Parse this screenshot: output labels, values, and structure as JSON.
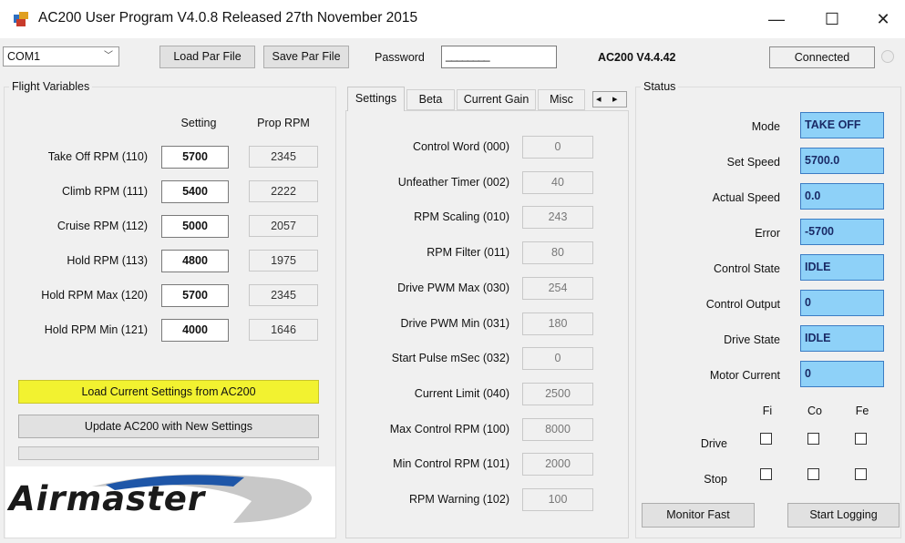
{
  "window": {
    "title": "AC200 User Program V4.0.8 Released 27th November 2015",
    "controls": {
      "minimize": "—",
      "maximize": "☐",
      "close": "✕"
    }
  },
  "toolbar": {
    "com_port": "COM1",
    "load_par_file": "Load Par File",
    "save_par_file": "Save Par File",
    "password_label": "Password",
    "password_value": "________",
    "version": "AC200 V4.4.42",
    "connection_status": "Connected"
  },
  "flight": {
    "title": "Flight Variables",
    "col_setting": "Setting",
    "col_prop_rpm": "Prop RPM",
    "rows": [
      {
        "label": "Take Off RPM (110)",
        "setting": "5700",
        "prop": "2345"
      },
      {
        "label": "Climb RPM (111)",
        "setting": "5400",
        "prop": "2222"
      },
      {
        "label": "Cruise RPM (112)",
        "setting": "5000",
        "prop": "2057"
      },
      {
        "label": "Hold RPM (113)",
        "setting": "4800",
        "prop": "1975"
      },
      {
        "label": "Hold RPM Max (120)",
        "setting": "5700",
        "prop": "2345"
      },
      {
        "label": "Hold RPM Min (121)",
        "setting": "4000",
        "prop": "1646"
      }
    ],
    "load_current": "Load Current Settings from AC200",
    "update": "Update AC200 with New Settings",
    "progress": 0
  },
  "logo": {
    "text": "Airmaster"
  },
  "tabs": {
    "labels": [
      "Settings",
      "Beta",
      "Current Gain",
      "Misc"
    ],
    "scroll_left": "◂",
    "scroll_right": "▸",
    "active": 0
  },
  "settings": [
    {
      "label": "Control Word (000)",
      "value": "0"
    },
    {
      "label": "Unfeather Timer (002)",
      "value": "40"
    },
    {
      "label": "RPM Scaling (010)",
      "value": "243"
    },
    {
      "label": "RPM Filter (011)",
      "value": "80"
    },
    {
      "label": "Drive PWM Max (030)",
      "value": "254"
    },
    {
      "label": "Drive PWM Min (031)",
      "value": "180"
    },
    {
      "label": "Start Pulse mSec (032)",
      "value": "0"
    },
    {
      "label": "Current Limit (040)",
      "value": "2500"
    },
    {
      "label": "Max Control RPM (100)",
      "value": "8000"
    },
    {
      "label": "Min Control RPM (101)",
      "value": "2000"
    },
    {
      "label": "RPM Warning (102)",
      "value": "100"
    }
  ],
  "status": {
    "title": "Status",
    "rows": [
      {
        "label": "Mode",
        "value": "TAKE OFF"
      },
      {
        "label": "Set Speed",
        "value": "5700.0"
      },
      {
        "label": "Actual Speed",
        "value": "0.0"
      },
      {
        "label": "Error",
        "value": "-5700"
      },
      {
        "label": "Control State",
        "value": "IDLE"
      },
      {
        "label": "Control Output",
        "value": "0"
      },
      {
        "label": "Drive State",
        "value": "IDLE"
      },
      {
        "label": "Motor Current",
        "value": "0"
      }
    ],
    "check_cols": [
      "Fi",
      "Co",
      "Fe"
    ],
    "check_rows": [
      "Drive",
      "Stop"
    ],
    "monitor_fast": "Monitor Fast",
    "start_logging": "Start Logging"
  },
  "colors": {
    "highlight_button": "#f2f230",
    "status_field": "#8ed1f8",
    "logo_blue": "#1e56a8"
  }
}
